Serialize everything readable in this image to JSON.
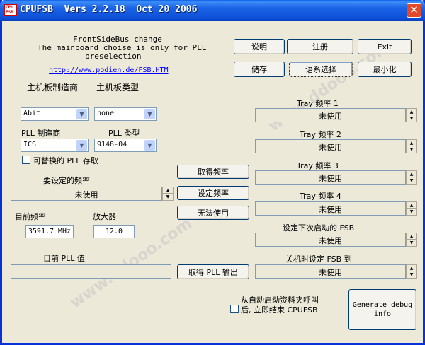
{
  "window": {
    "title": "CPUFSB  Vers 2.2.18  Oct 20 2006",
    "icon_text": "CPU FSB",
    "close_symbol": "✕"
  },
  "header": {
    "line1": "FrontSideBus change",
    "line2": "The mainboard choise is only for PLL",
    "line3": "preselection",
    "url": "http://www.podien.de/FSB.HTM"
  },
  "buttons": {
    "explain": "说明",
    "register": "注册",
    "exit": "Exit",
    "store": "储存",
    "lang_select": "语系选择",
    "minimize": "最小化",
    "get_freq": "取得频率",
    "set_freq": "设定频率",
    "unusable": "无法使用",
    "get_pll": "取得 PLL 输出",
    "debug": "Generate debug\ninfo"
  },
  "mainboard": {
    "maker_label": "主机板制造商",
    "type_label": "主机板类型",
    "maker_value": "Abit",
    "type_value": "none"
  },
  "pll": {
    "maker_label": "PLL 制造商",
    "type_label": "PLL 类型",
    "maker_value": "ICS",
    "type_value": "9148-04",
    "alt_label": "可替换的 PLL 存取"
  },
  "target_freq": {
    "label": "要设定的频率",
    "value": "未使用"
  },
  "current": {
    "freq_label": "目前频率",
    "freq_value": "3591.7 MHz",
    "mult_label": "放大器",
    "mult_value": "12.0"
  },
  "pll_value": {
    "label": "目前 PLL 值",
    "value": ""
  },
  "tray": [
    {
      "label": "Tray 频率 1",
      "value": "未使用"
    },
    {
      "label": "Tray 频率 2",
      "value": "未使用"
    },
    {
      "label": "Tray 频率 3",
      "value": "未使用"
    },
    {
      "label": "Tray 频率 4",
      "value": "未使用"
    }
  ],
  "next_boot": {
    "label": "设定下次启动的 FSB",
    "value": "未使用"
  },
  "shutdown": {
    "label": "关机时设定 FSB 到",
    "value": "未使用"
  },
  "autostart": {
    "line1": "从自动启动资料夹呼叫",
    "line2": "后, 立即结束 CPUFSB"
  },
  "icons": {
    "spin_up": "▲",
    "spin_down": "▼",
    "combo_arrow": "▼"
  },
  "colors": {
    "titlebar": "#0c4fd6",
    "window_bg": "#ece9d8",
    "close": "#e04a2a",
    "link": "#0000ff"
  }
}
